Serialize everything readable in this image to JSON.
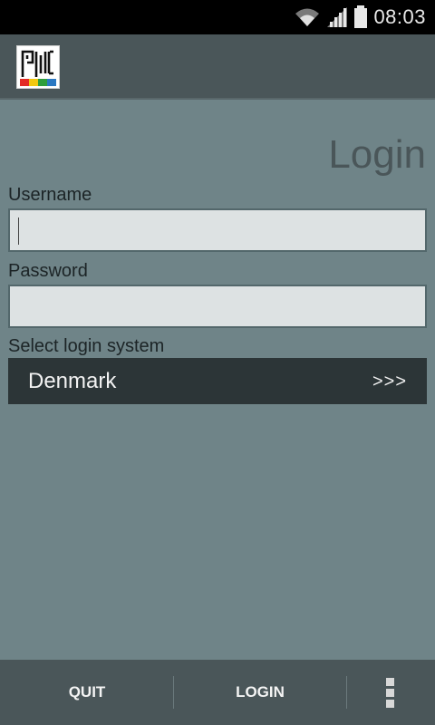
{
  "status_bar": {
    "time": "08:03",
    "icons": [
      "wifi-icon",
      "signal-icon",
      "battery-icon"
    ]
  },
  "action_bar": {
    "logo_icon": "app-logo-icon"
  },
  "login_form": {
    "title": "Login",
    "username_label": "Username",
    "username_value": "",
    "password_label": "Password",
    "password_value": "",
    "system_label": "Select login system",
    "system_value": "Denmark",
    "system_arrow": ">>>"
  },
  "bottom_bar": {
    "quit_label": "QUIT",
    "login_label": "LOGIN",
    "overflow_icon": "overflow-menu-icon"
  },
  "colors": {
    "background": "#6f8488",
    "bar": "#4a5659",
    "field": "#dde2e3",
    "select": "#2c3537"
  }
}
